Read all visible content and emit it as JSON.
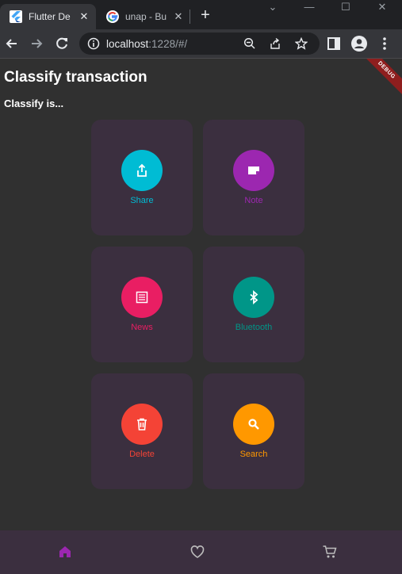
{
  "browser": {
    "tabs": [
      {
        "title": "Flutter De",
        "close": "✕"
      },
      {
        "title": "unap - Bu",
        "close": "✕"
      }
    ],
    "new_tab": "+",
    "window_controls": {
      "chevron": "⌄",
      "minimize": "—",
      "maximize": "☐",
      "close": "✕"
    },
    "address": {
      "host": "localhost",
      "rest": ":1228/#/"
    }
  },
  "app": {
    "title": "Classify transaction",
    "subtitle": "Classify is...",
    "debug_banner": "DEBUG",
    "cards": [
      {
        "label": "Share",
        "icon": "share-icon",
        "color": "#00bcd4"
      },
      {
        "label": "Note",
        "icon": "note-icon",
        "color": "#9c27b0"
      },
      {
        "label": "News",
        "icon": "news-icon",
        "color": "#e91e63"
      },
      {
        "label": "Bluetooth",
        "icon": "bluetooth-icon",
        "color": "#009688"
      },
      {
        "label": "Delete",
        "icon": "delete-icon",
        "color": "#f44336"
      },
      {
        "label": "Search",
        "icon": "search-icon",
        "color": "#ff9800"
      }
    ],
    "bottom_nav": [
      {
        "icon": "home-icon",
        "color": "#9c27b0"
      },
      {
        "icon": "heart-icon",
        "color": "#bdbdbd"
      },
      {
        "icon": "cart-icon",
        "color": "#bdbdbd"
      }
    ]
  }
}
